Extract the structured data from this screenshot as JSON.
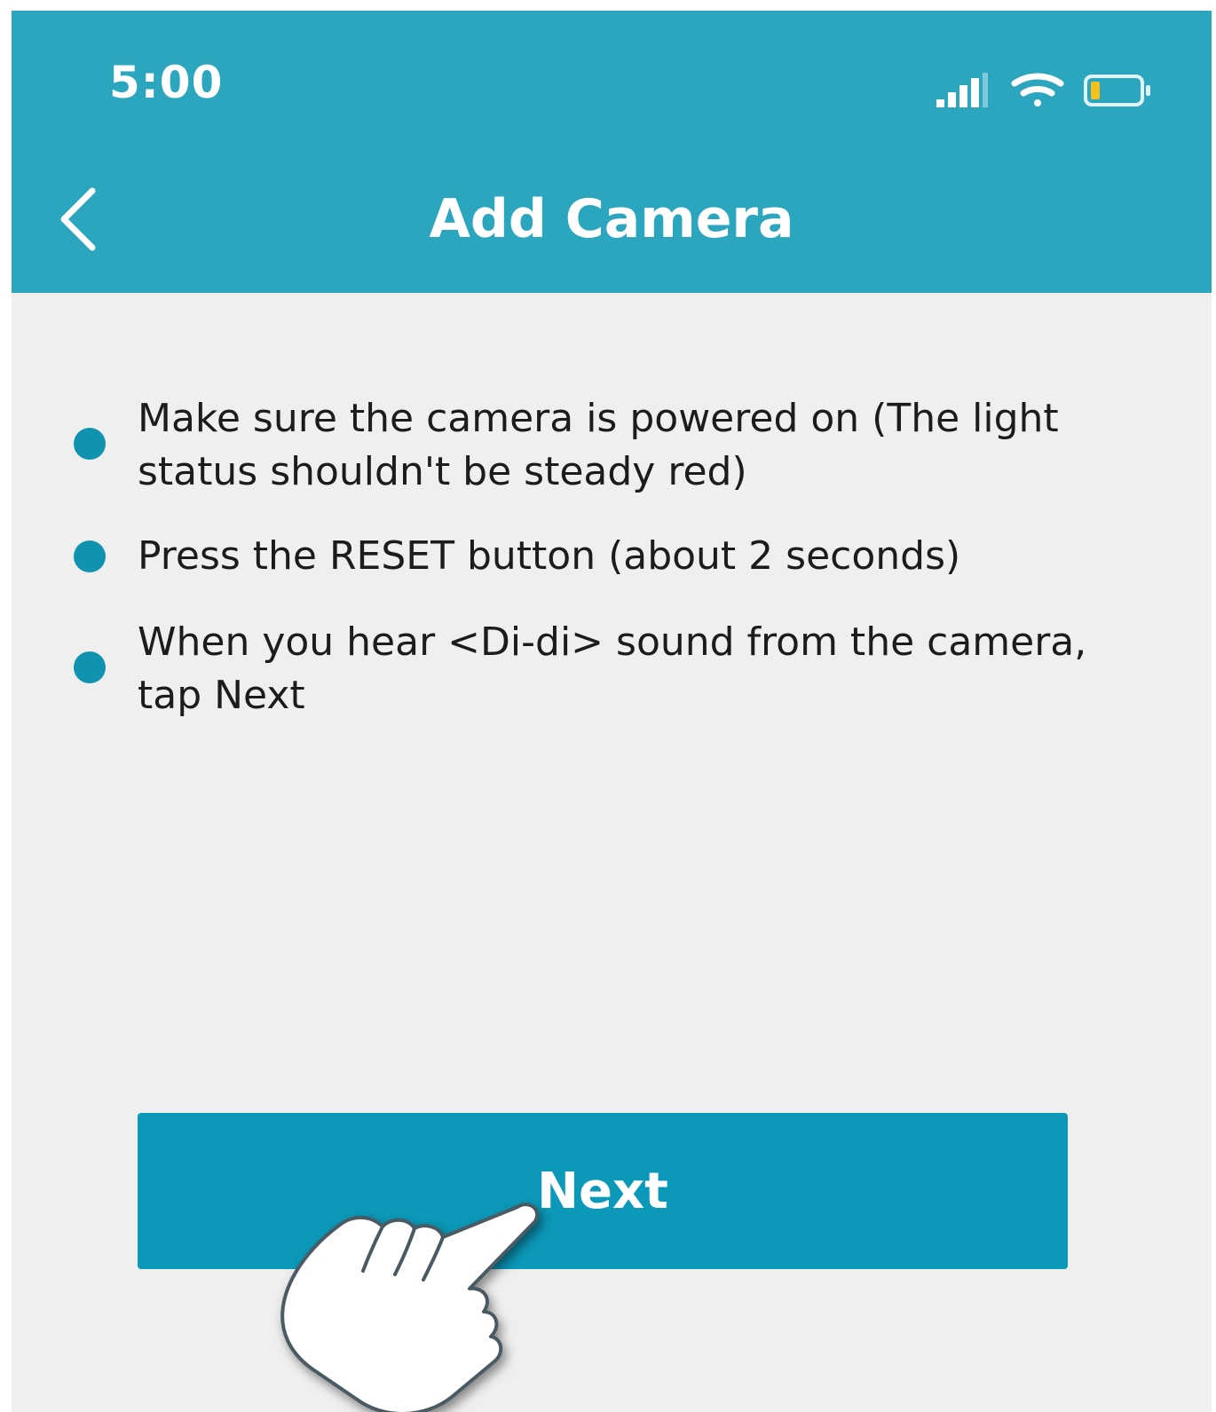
{
  "status_bar": {
    "time": "5:00",
    "icons": [
      "cellular-signal-icon",
      "wifi-icon",
      "battery-low-icon"
    ]
  },
  "header": {
    "title": "Add Camera",
    "back_icon": "chevron-left-icon"
  },
  "steps": [
    {
      "text": "Make sure the camera is powered on (The light status shouldn't be steady red)"
    },
    {
      "text": "Press the RESET button (about 2 seconds)"
    },
    {
      "text": "When you hear <Di-di> sound from the camera, tap Next"
    }
  ],
  "next_button": {
    "label": "Next"
  },
  "overlay": {
    "icon": "pointing-hand-icon"
  },
  "colors": {
    "header_bg": "#2ca6bf",
    "accent": "#1192b1",
    "button_bg": "#0b98b9",
    "page_bg": "#efefef",
    "battery_level": "#f4c21b"
  }
}
